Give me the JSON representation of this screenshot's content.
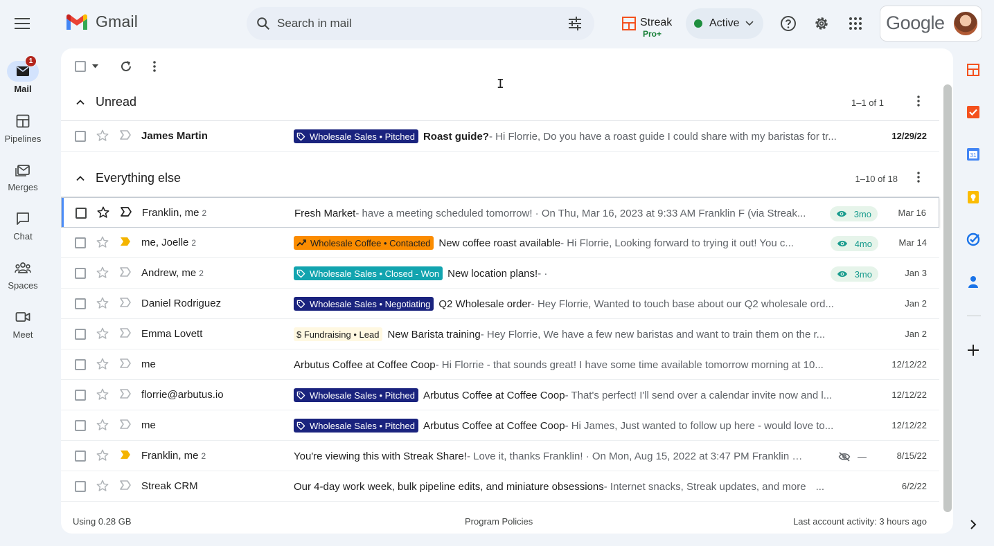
{
  "app": {
    "name": "Gmail"
  },
  "search": {
    "placeholder": "Search in mail"
  },
  "streak": {
    "label": "Streak",
    "plan": "Pro+"
  },
  "status": {
    "label": "Active",
    "color": "#1e8e3e"
  },
  "account": {
    "brand": "Google"
  },
  "left_nav": {
    "items": [
      {
        "label": "Mail",
        "icon": "mail-icon",
        "badge": "1",
        "active": true
      },
      {
        "label": "Pipelines",
        "icon": "pipelines-icon"
      },
      {
        "label": "Merges",
        "icon": "merges-icon"
      },
      {
        "label": "Chat",
        "icon": "chat-icon"
      },
      {
        "label": "Spaces",
        "icon": "spaces-icon"
      },
      {
        "label": "Meet",
        "icon": "meet-icon"
      }
    ]
  },
  "sections": {
    "unread": {
      "title": "Unread",
      "count": "1–1 of 1"
    },
    "everything_else": {
      "title": "Everything else",
      "count": "1–10 of 18"
    }
  },
  "tag_colors": {
    "pitched": "#1a237e",
    "contacted": "#fb8c00",
    "closed_won": "#12a4af",
    "negotiating": "#1a237e",
    "fundraising": "#fff8e1",
    "views": "#e6f4ea"
  },
  "unread_rows": [
    {
      "sender": "James Martin",
      "count": "",
      "tag": "Wholesale Sales • Pitched",
      "subject": "Roast guide?",
      "snippet": " - Hi Florrie, Do you have a roast guide I could share with my baristas for tr...",
      "date": "12/29/22"
    }
  ],
  "rows": [
    {
      "sender": "Franklin, me",
      "count": "2",
      "tag": "",
      "subject": "Fresh Market",
      "snippet": " - have a meeting scheduled tomorrow! · On Thu, Mar 16, 2023 at 9:33 AM Franklin F (via Streak...",
      "views": "3mo",
      "date": "Mar 16"
    },
    {
      "sender": "me, Joelle",
      "count": "2",
      "tag": "Wholesale Coffee • Contacted",
      "subject": "New coffee roast available",
      "snippet": " - Hi Florrie, Looking forward to trying it out! You c...",
      "views": "4mo",
      "date": "Mar 14"
    },
    {
      "sender": "Andrew, me",
      "count": "2",
      "tag": "Wholesale Sales • Closed - Won",
      "subject": "New location plans!",
      "snippet": " - ·",
      "views": "3mo",
      "date": "Jan 3"
    },
    {
      "sender": "Daniel Rodriguez",
      "count": "",
      "tag": "Wholesale Sales • Negotiating",
      "subject": "Q2 Wholesale order",
      "snippet": " - Hey Florrie, Wanted to touch base about our Q2 wholesale ord...",
      "date": "Jan 2"
    },
    {
      "sender": "Emma Lovett",
      "count": "",
      "tag": "$ Fundraising • Lead",
      "subject": "New Barista training",
      "snippet": " - Hey Florrie, We have a few new baristas and want to train them on the r...",
      "date": "Jan 2"
    },
    {
      "sender": "me",
      "count": "",
      "tag": "",
      "subject": "Arbutus Coffee at Coffee Coop",
      "snippet": " - Hi Florrie - that sounds great! I have some time available tomorrow morning at 10...",
      "date": "12/12/22"
    },
    {
      "sender": "florrie@arbutus.io",
      "count": "",
      "tag": "Wholesale Sales • Pitched",
      "subject": "Arbutus Coffee at Coffee Coop",
      "snippet": " - That's perfect! I'll send over a calendar invite now and l...",
      "date": "12/12/22"
    },
    {
      "sender": "me",
      "count": "",
      "tag": "Wholesale Sales • Pitched",
      "subject": "Arbutus Coffee at Coffee Coop",
      "snippet": " - Hi James, Just wanted to follow up here - would love to...",
      "date": "12/12/22"
    },
    {
      "sender": "Franklin, me",
      "count": "2",
      "tag": "",
      "subject": "You're viewing this with Streak Share!",
      "snippet": " - Love it, thanks Franklin! · On Mon, Aug 15, 2022 at 3:47 PM Franklin Fe...",
      "views": "—",
      "date": "8/15/22"
    },
    {
      "sender": "Streak CRM",
      "count": "",
      "tag": "",
      "subject": "Our 4-day work week, bulk pipeline edits, and miniature obsessions",
      "snippet": " - Internet snacks, Streak updates, and more",
      "extra": "...",
      "date": "6/2/22"
    }
  ],
  "footer": {
    "storage": "Using 0.28 GB",
    "policies": "Program Policies",
    "activity": "Last account activity: 3 hours ago"
  }
}
